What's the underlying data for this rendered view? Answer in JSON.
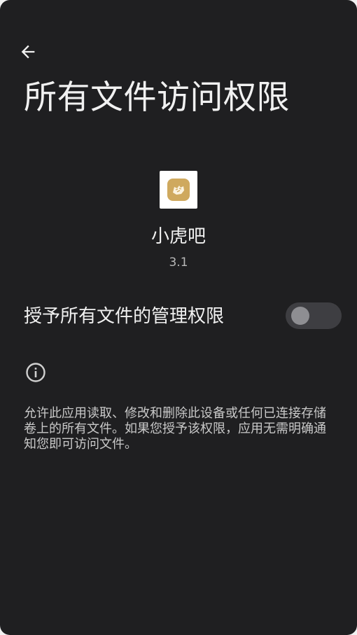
{
  "header": {
    "back_icon": "arrow-left-icon",
    "title": "所有文件访问权限"
  },
  "app": {
    "icon": "tiger-app-icon",
    "icon_bg": "#ffffff",
    "icon_accent": "#cfa95e",
    "name": "小虎吧",
    "version": "3.1"
  },
  "permission": {
    "label": "授予所有文件的管理权限",
    "enabled": false
  },
  "info": {
    "icon": "info-icon",
    "description": "允许此应用读取、修改和删除此设备或任何已连接存储卷上的所有文件。如果您授予该权限，应用无需明确通知您即可访问文件。"
  },
  "colors": {
    "background": "#1f1f21",
    "text_primary": "#f1f1f1",
    "text_secondary": "#c9c9c9",
    "toggle_track_off": "#3e3e42",
    "toggle_thumb_off": "#8e8e92"
  }
}
